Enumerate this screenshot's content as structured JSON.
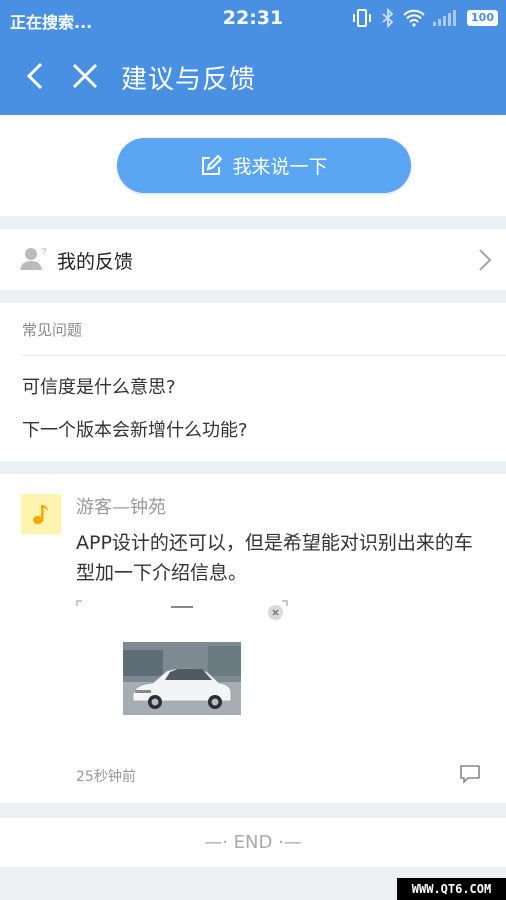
{
  "status_bar": {
    "left_text": "正在搜索...",
    "time": "22:31",
    "battery": "100"
  },
  "app_bar": {
    "title": "建议与反馈",
    "back_icon": "chevron-left-icon",
    "close_icon": "close-icon"
  },
  "say_button": {
    "label": "我来说一下",
    "icon": "edit-icon"
  },
  "my_feedback": {
    "label": "我的反馈",
    "icon": "user-question-icon"
  },
  "faq": {
    "heading": "常见问题",
    "items": [
      {
        "label": "可信度是什么意思?"
      },
      {
        "label": "下一个版本会新增什么功能?"
      }
    ]
  },
  "post": {
    "author": "游客—钟苑",
    "content": "APP设计的还可以，但是希望能对识别出来的车型加一下介绍信息。",
    "time_ago": "25秒钟前",
    "avatar_icon": "music-note-icon",
    "image_desc_icon": "car-photo"
  },
  "end_text": "—· END ·—",
  "watermark": "WWW.QT6.COM",
  "colors": {
    "primary": "#4a90e2",
    "button": "#5aa6f2",
    "avatar_bg": "#fff3b0"
  }
}
